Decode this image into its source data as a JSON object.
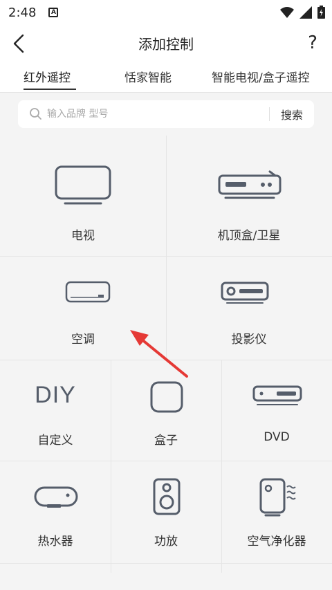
{
  "status_bar": {
    "time": "2:48",
    "notification_letter": "A"
  },
  "header": {
    "title": "添加控制",
    "help_label": "?"
  },
  "tabs": [
    {
      "label": "红外遥控",
      "active": true
    },
    {
      "label": "恬家智能",
      "active": false
    },
    {
      "label": "智能电视/盒子遥控",
      "active": false
    }
  ],
  "search": {
    "placeholder": "输入品牌 型号",
    "button_label": "搜索"
  },
  "devices": {
    "tv": "电视",
    "stb": "机顶盒/卫星",
    "ac": "空调",
    "projector": "投影仪",
    "diy_icon_text": "DIY",
    "diy": "自定义",
    "box": "盒子",
    "dvd": "DVD",
    "water_heater": "热水器",
    "amplifier": "功放",
    "air_purifier": "空气净化器"
  },
  "colors": {
    "icon": "#555d6a",
    "arrow": "#e53935",
    "background": "#f4f4f4"
  }
}
